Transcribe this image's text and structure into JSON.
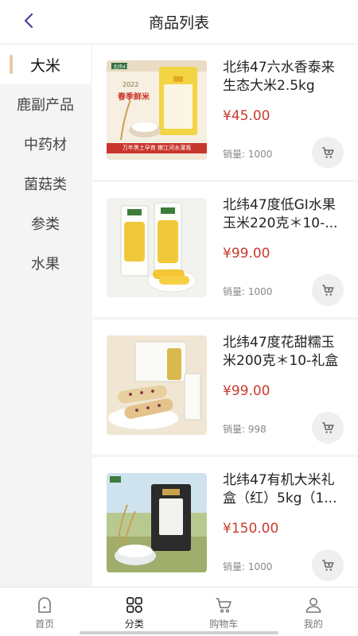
{
  "header": {
    "title": "商品列表"
  },
  "sidebar": {
    "categories": [
      {
        "label": "大米"
      },
      {
        "label": "鹿副产品"
      },
      {
        "label": "中药材"
      },
      {
        "label": "菌菇类"
      },
      {
        "label": "参类"
      },
      {
        "label": "水果"
      }
    ]
  },
  "products": [
    {
      "name": "北纬47六水香泰来生态大米2.5kg",
      "price": "¥45.00",
      "sales": "销量: 1000"
    },
    {
      "name": "北纬47度低GI水果玉米220克＊10-...",
      "price": "¥99.00",
      "sales": "销量: 1000"
    },
    {
      "name": "北纬47度花甜糯玉米200克＊10-礼盒",
      "price": "¥99.00",
      "sales": "销量: 998"
    },
    {
      "name": "北纬47有机大米礼盒（红）5kg（1...",
      "price": "¥150.00",
      "sales": "销量: 1000"
    }
  ],
  "thumbs": {
    "rice_box_year": "2022",
    "rice_box_title": "春季鲜米",
    "rice_box_banner": "万年黑土孕育 嫩江河水灌溉",
    "rice_box_brand": "北纬47"
  },
  "tabbar": {
    "tabs": [
      {
        "label": "首页",
        "icon": "home-icon"
      },
      {
        "label": "分类",
        "icon": "category-icon"
      },
      {
        "label": "购物车",
        "icon": "cart-icon"
      },
      {
        "label": "我的",
        "icon": "user-icon"
      }
    ]
  },
  "colors": {
    "price": "#c83a2f",
    "active_bar": "#e8c9a4",
    "back_arrow": "#4b3f9e"
  }
}
